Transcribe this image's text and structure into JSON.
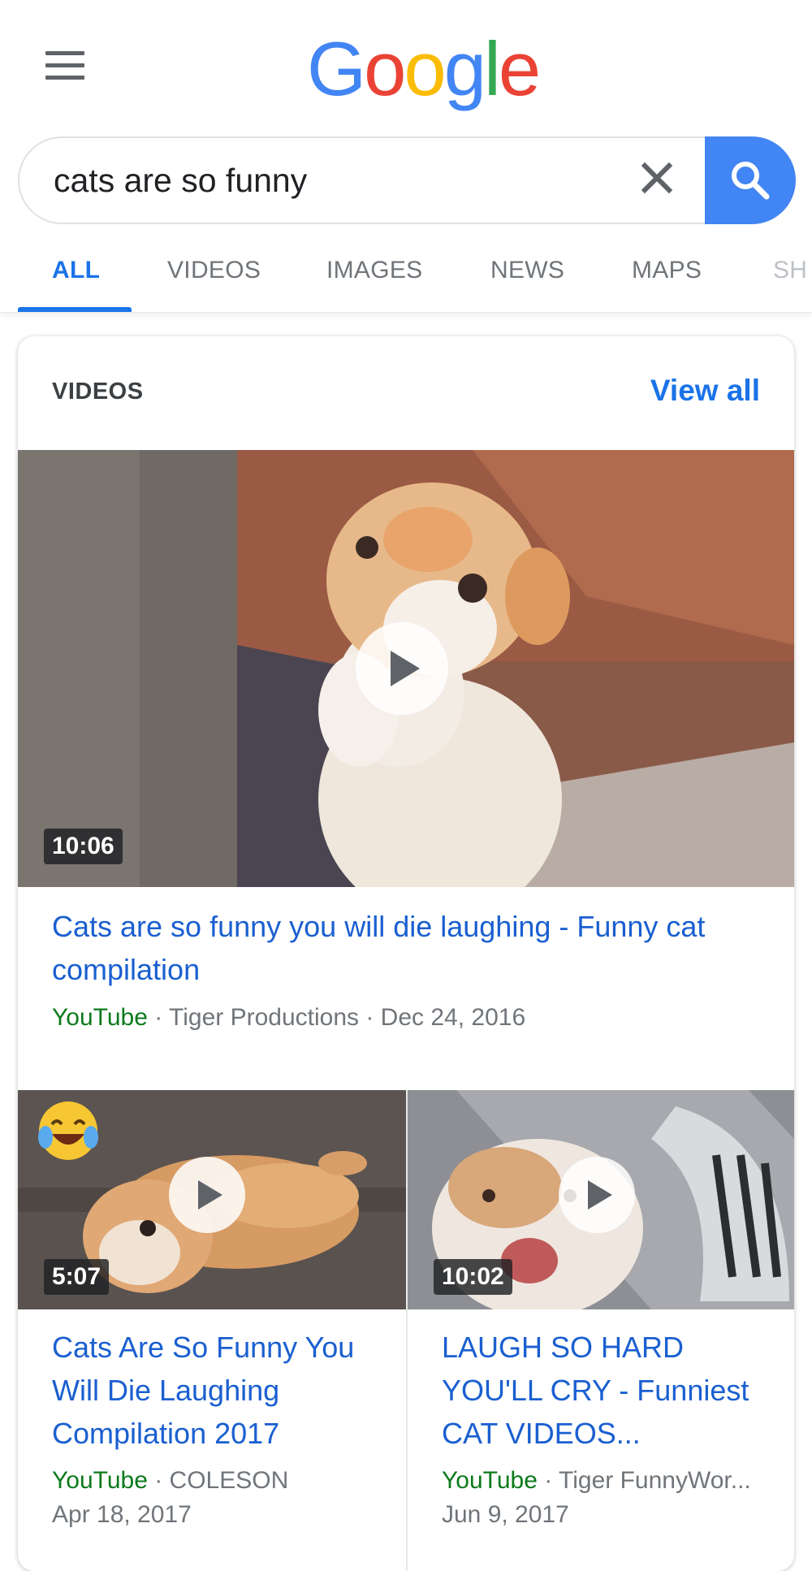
{
  "header": {
    "logo_text": "Google",
    "menu_icon": "hamburger-menu-icon"
  },
  "search": {
    "query": "cats are so funny",
    "clear_icon": "close-icon",
    "search_icon": "search-icon"
  },
  "tabs": [
    {
      "label": "ALL",
      "active": true
    },
    {
      "label": "VIDEOS",
      "active": false
    },
    {
      "label": "IMAGES",
      "active": false
    },
    {
      "label": "NEWS",
      "active": false
    },
    {
      "label": "MAPS",
      "active": false
    },
    {
      "label": "SH",
      "active": false
    }
  ],
  "videos_card": {
    "title": "VIDEOS",
    "view_all_label": "View all",
    "featured": {
      "duration": "10:06",
      "title": "Cats are so funny you will die laughing - Funny cat compilation",
      "source": "YouTube",
      "meta": " · Tiger Productions · Dec 24, 2016"
    },
    "items": [
      {
        "duration": "5:07",
        "title": "Cats Are So Funny You Will Die Laughing Compilation 2017",
        "source": "YouTube",
        "channel": " · COLESON",
        "date": "Apr 18, 2017",
        "badge_icon": "laughing-tears-emoji-icon"
      },
      {
        "duration": "10:02",
        "title": "LAUGH SO HARD YOU'LL CRY - Funniest CAT VIDEOS...",
        "source": "YouTube",
        "channel": " · Tiger FunnyWor...",
        "date": "Jun 9, 2017"
      }
    ]
  },
  "colors": {
    "accent_blue": "#1a73e8",
    "search_button": "#4285F4",
    "source_green": "#0b7a1b"
  }
}
